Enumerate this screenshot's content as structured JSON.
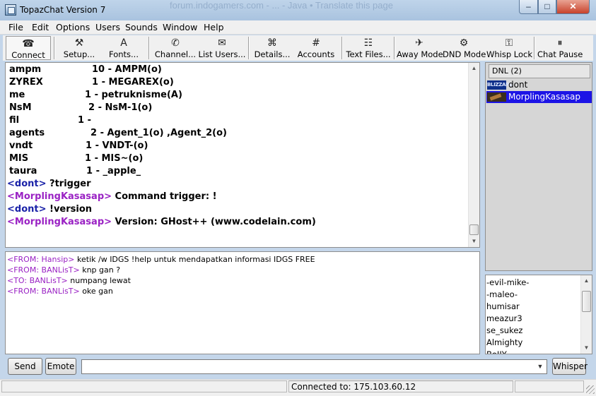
{
  "window": {
    "title": "TopazChat Version 7",
    "background_ghost_text": "forum.indogamers.com - ... - Java  •  Translate this page",
    "controls": {
      "minimize": "–",
      "maximize": "□",
      "close": "✕"
    }
  },
  "menu": [
    "File",
    "Edit",
    "Options",
    "Users",
    "Sounds",
    "Window",
    "Help"
  ],
  "toolbar": [
    {
      "label": "Connect",
      "icon": "connect-icon",
      "glyph": "☎"
    },
    {
      "label": "Setup...",
      "icon": "setup-icon",
      "glyph": "⚒"
    },
    {
      "label": "Fonts...",
      "icon": "fonts-icon",
      "glyph": "A"
    },
    {
      "label": "Channel...",
      "icon": "channel-icon",
      "glyph": "✆"
    },
    {
      "label": "List Users...",
      "icon": "list-users-icon",
      "glyph": "✉"
    },
    {
      "label": "Details...",
      "icon": "details-icon",
      "glyph": "⌘"
    },
    {
      "label": "Accounts",
      "icon": "accounts-icon",
      "glyph": "#"
    },
    {
      "label": "Text Files...",
      "icon": "text-files-icon",
      "glyph": "☷"
    },
    {
      "label": "Away Mode",
      "icon": "away-mode-icon",
      "glyph": "✈"
    },
    {
      "label": "DND Mode",
      "icon": "dnd-mode-icon",
      "glyph": "⚙"
    },
    {
      "label": "Whisp Lock",
      "icon": "whisp-lock-icon",
      "glyph": "⚿"
    },
    {
      "label": "Chat Pause",
      "icon": "chat-pause-icon",
      "glyph": "⏸"
    }
  ],
  "chat": {
    "table_rows": [
      {
        "name": "ampm",
        "info": "10 - AMPM(o)"
      },
      {
        "name": "ZYREX",
        "info": "1 - MEGAREX(o)"
      },
      {
        "name": "me",
        "info": "1 - petruknisme(A)"
      },
      {
        "name": "NsM",
        "info": "2 - NsM-1(o)"
      },
      {
        "name": "fil",
        "info": "1 -"
      },
      {
        "name": "agents",
        "info": "2 - Agent_1(o) ,Agent_2(o)"
      },
      {
        "name": "vndt",
        "info": "1 - VNDT-(o)"
      },
      {
        "name": "MIS",
        "info": "1 - MIS~(o)"
      },
      {
        "name": "taura",
        "info": "1 - _apple_"
      }
    ],
    "messages": [
      {
        "nick": "<dont>",
        "text": " ?trigger",
        "color": "#1a22a8"
      },
      {
        "nick": "<MorplingKasasap>",
        "text": " Command trigger: !",
        "color": "#9a22c4"
      },
      {
        "nick": "<dont>",
        "text": " !version",
        "color": "#1a22a8"
      },
      {
        "nick": "<MorplingKasasap>",
        "text": " Version: GHost++ (www.codelain.com)",
        "color": "#9a22c4"
      }
    ]
  },
  "whispers": [
    {
      "tag": "<FROM: Hansip>",
      "text": " ketik /w IDGS !help untuk mendapatkan informasi IDGS FREE"
    },
    {
      "tag": "<FROM: BANLisT>",
      "text": " knp gan ?"
    },
    {
      "tag": "<TO: BANLisT>",
      "text": " numpang lewat"
    },
    {
      "tag": "<FROM: BANLisT>",
      "text": " oke gan"
    }
  ],
  "channel": {
    "title": "DNL (2)",
    "users": [
      {
        "name": "dont",
        "badge": "BLIZZARD",
        "selected": false
      },
      {
        "name": "MorplingKasasap",
        "badge": "",
        "selected": true
      }
    ]
  },
  "user_list": [
    "-evil-mike-",
    "-maleo-",
    "humisar",
    "meazur3",
    "se_sukez",
    "Almighty",
    "BoIIY"
  ],
  "input": {
    "send_label": "Send",
    "emote_label": "Emote",
    "whisper_label": "Whisper",
    "message_value": ""
  },
  "status": {
    "connection": "Connected to: 175.103.60.12"
  },
  "colors": {
    "self_nick": "#1a22a8",
    "other_nick": "#9a22c4",
    "selection": "#1c14e6"
  }
}
